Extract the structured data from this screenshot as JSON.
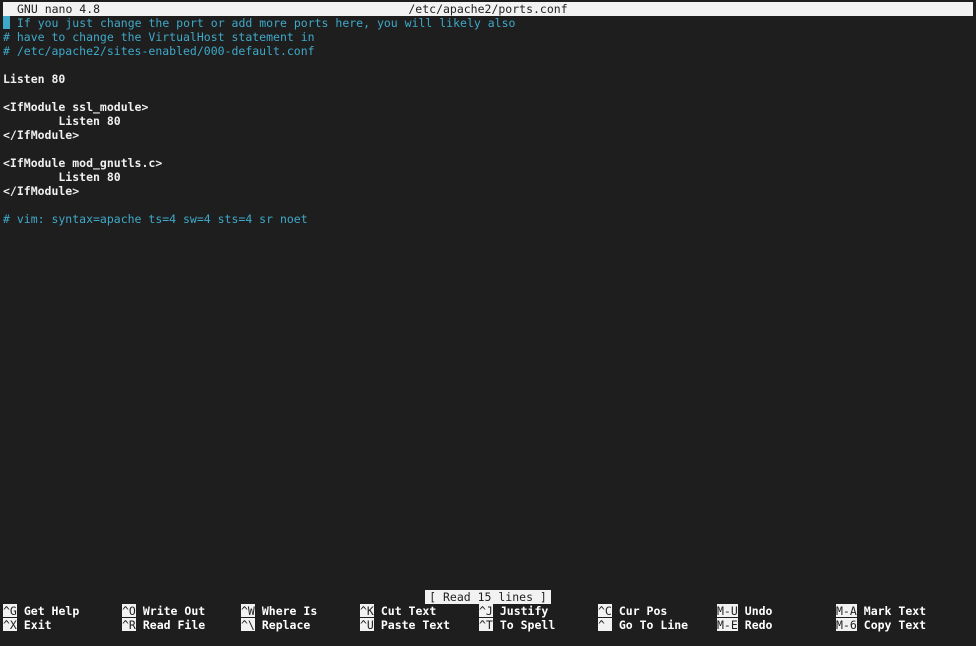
{
  "titlebar": {
    "app": "GNU nano 4.8",
    "file": "/etc/apache2/ports.conf"
  },
  "lines": [
    {
      "text": " If you just change the port or add more ports here, you will likely also",
      "kind": "comment",
      "cursor": true
    },
    {
      "text": "# have to change the VirtualHost statement in",
      "kind": "comment"
    },
    {
      "text": "# /etc/apache2/sites-enabled/000-default.conf",
      "kind": "comment"
    },
    {
      "text": "",
      "kind": "plain"
    },
    {
      "text": "Listen 80",
      "kind": "plain"
    },
    {
      "text": "",
      "kind": "plain"
    },
    {
      "text": "<IfModule ssl_module>",
      "kind": "plain"
    },
    {
      "text": "        Listen 80",
      "kind": "plain"
    },
    {
      "text": "</IfModule>",
      "kind": "plain"
    },
    {
      "text": "",
      "kind": "plain"
    },
    {
      "text": "<IfModule mod_gnutls.c>",
      "kind": "plain"
    },
    {
      "text": "        Listen 80",
      "kind": "plain"
    },
    {
      "text": "</IfModule>",
      "kind": "plain"
    },
    {
      "text": "",
      "kind": "plain"
    },
    {
      "text": "# vim: syntax=apache ts=4 sw=4 sts=4 sr noet",
      "kind": "comment"
    }
  ],
  "status": "[ Read 15 lines ]",
  "shortcuts": [
    {
      "key": "^G",
      "label": "Get Help",
      "name": "get-help"
    },
    {
      "key": "^X",
      "label": "Exit",
      "name": "exit"
    },
    {
      "key": "^O",
      "label": "Write Out",
      "name": "write-out"
    },
    {
      "key": "^R",
      "label": "Read File",
      "name": "read-file"
    },
    {
      "key": "^W",
      "label": "Where Is",
      "name": "where-is"
    },
    {
      "key": "^\\",
      "label": "Replace",
      "name": "replace"
    },
    {
      "key": "^K",
      "label": "Cut Text",
      "name": "cut-text"
    },
    {
      "key": "^U",
      "label": "Paste Text",
      "name": "paste-text"
    },
    {
      "key": "^J",
      "label": "Justify",
      "name": "justify"
    },
    {
      "key": "^T",
      "label": "To Spell",
      "name": "to-spell"
    },
    {
      "key": "^C",
      "label": "Cur Pos",
      "name": "cur-pos"
    },
    {
      "key": "^_",
      "label": "Go To Line",
      "name": "go-to-line"
    },
    {
      "key": "M-U",
      "label": "Undo",
      "name": "undo"
    },
    {
      "key": "M-E",
      "label": "Redo",
      "name": "redo"
    },
    {
      "key": "M-A",
      "label": "Mark Text",
      "name": "mark-text"
    },
    {
      "key": "M-6",
      "label": "Copy Text",
      "name": "copy-text"
    }
  ],
  "colors": {
    "background": "#1e1e1e",
    "comment": "#3fa9c9",
    "inverse_bg": "#f2f2f2"
  }
}
